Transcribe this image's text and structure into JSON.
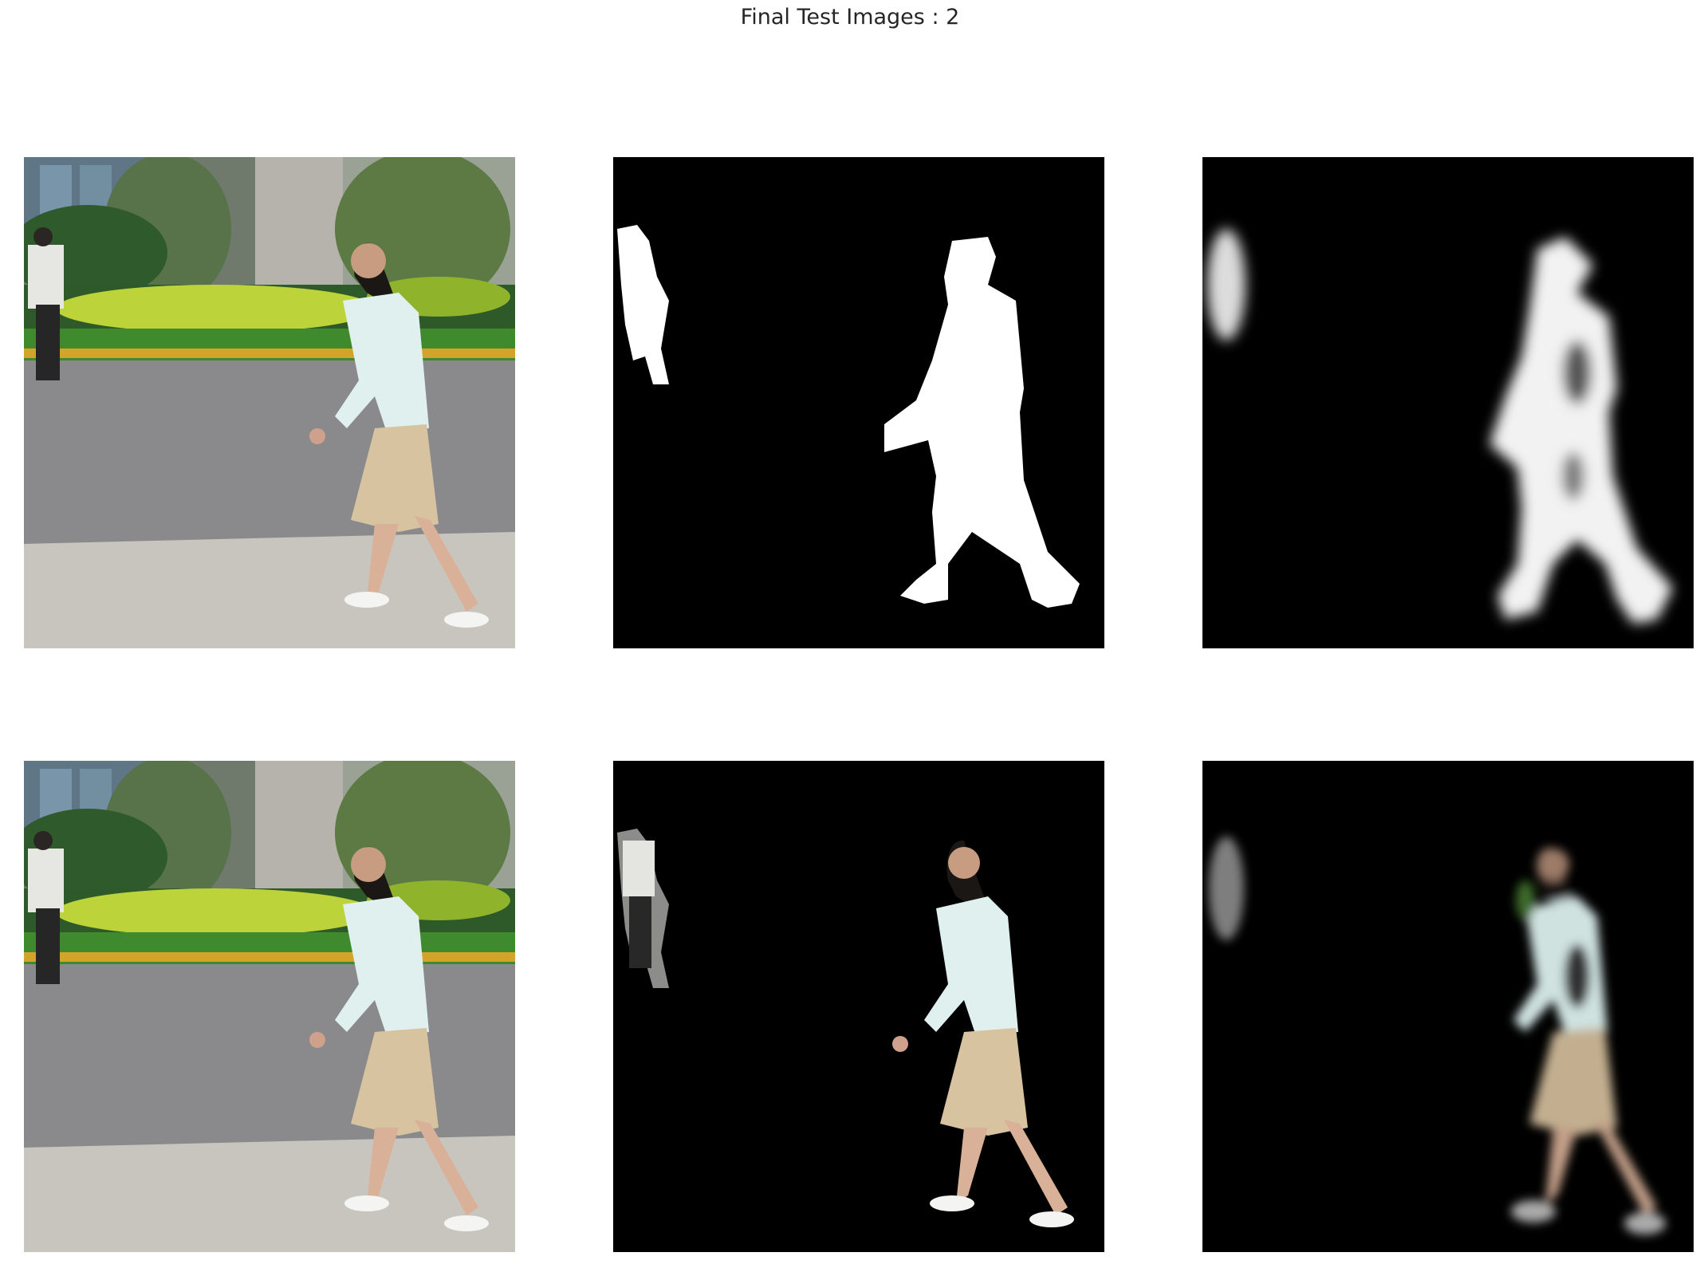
{
  "figure": {
    "title": "Final Test Images : 2"
  },
  "colors": {
    "background": "#ffffff",
    "mask_black": "#000000",
    "mask_white": "#ffffff",
    "grass": "#3f7a2a",
    "hedge": "#b9d238",
    "road": "#8a8a8c",
    "sidewalk": "#c9c6c0",
    "shirt": "#dff0ee",
    "skirt": "#d8c3a0",
    "hair": "#1b1714"
  }
}
